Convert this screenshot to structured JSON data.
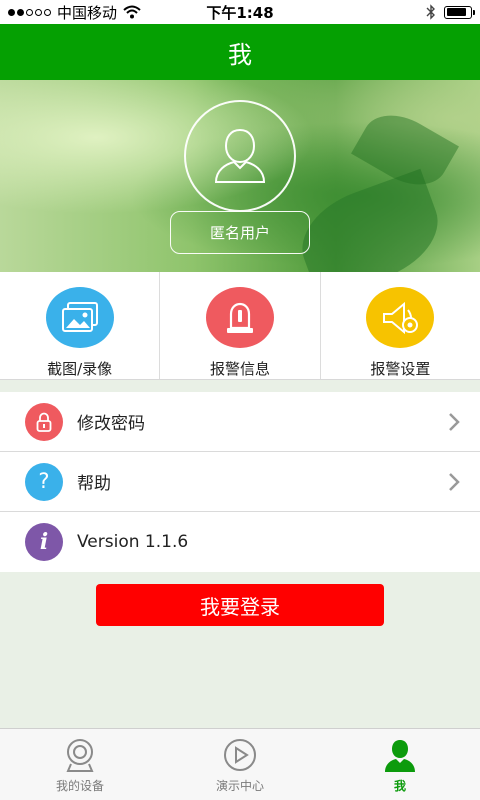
{
  "status_bar": {
    "carrier": "中国移动",
    "time": "下午1:48",
    "battery_level": 0.85
  },
  "header": {
    "title": "我"
  },
  "profile": {
    "username": "匿名用户"
  },
  "quick_actions": [
    {
      "label": "截图/录像",
      "icon": "gallery-icon",
      "color": "#3ab1ea"
    },
    {
      "label": "报警信息",
      "icon": "alarm-light-icon",
      "color": "#ef5a5f"
    },
    {
      "label": "报警设置",
      "icon": "alarm-settings-icon",
      "color": "#f7c300"
    }
  ],
  "menu": [
    {
      "label": "修改密码",
      "icon": "lock-icon",
      "color": "#ef5a5f",
      "has_arrow": true
    },
    {
      "label": "帮助",
      "icon": "question-icon",
      "color": "#3ab1ea",
      "has_arrow": true
    },
    {
      "label": "Version 1.1.6",
      "icon": "info-icon",
      "color": "#7e57a8",
      "has_arrow": false
    }
  ],
  "login_button": {
    "label": "我要登录",
    "color": "#ff0000"
  },
  "tabs": [
    {
      "label": "我的设备",
      "icon": "camera-icon",
      "active": false
    },
    {
      "label": "演示中心",
      "icon": "play-icon",
      "active": false
    },
    {
      "label": "我",
      "icon": "user-icon",
      "active": true
    }
  ],
  "colors": {
    "brand": "#05a002",
    "active_tab": "#0c9b0c"
  }
}
